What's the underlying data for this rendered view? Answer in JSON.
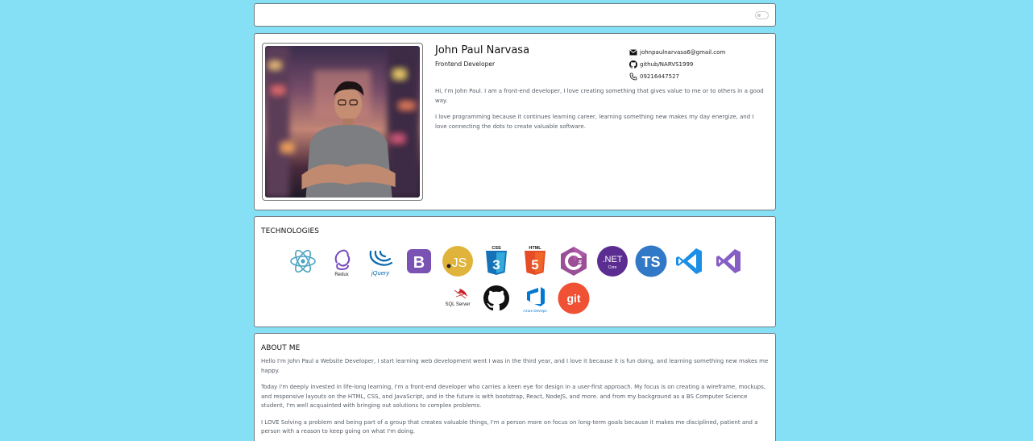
{
  "topbar": {
    "theme_toggle": "off"
  },
  "profile": {
    "name": "John Paul Narvasa",
    "role": "Frontend Developer",
    "contacts": [
      {
        "icon": "mail-icon",
        "text": "johnpaulnarvasa6@gmail.com"
      },
      {
        "icon": "github-icon",
        "text": "github/NARVS1999"
      },
      {
        "icon": "phone-icon",
        "text": "09216447527"
      }
    ],
    "bio": [
      "Hi, I'm John Paul. I am a front-end developer, I love creating something that gives value to me or to others in a good way.",
      "I love programming because it continues learning career, learning something new makes my day energize, and I love connecting the dots to create valuable software."
    ]
  },
  "technologies": {
    "title": "TECHNOLOGIES",
    "items": [
      {
        "icon": "react-icon",
        "label": ""
      },
      {
        "icon": "redux-icon",
        "label": "Redux"
      },
      {
        "icon": "jquery-icon",
        "label": "jQuery"
      },
      {
        "icon": "bootstrap-icon",
        "label": "B"
      },
      {
        "icon": "javascript-icon",
        "label": "JS"
      },
      {
        "icon": "css3-icon",
        "label": "CSS"
      },
      {
        "icon": "html5-icon",
        "label": "HTML"
      },
      {
        "icon": "csharp-icon",
        "label": "C#"
      },
      {
        "icon": "dotnet-core-icon",
        "label": ".NET"
      },
      {
        "icon": "typescript-icon",
        "label": "TS"
      },
      {
        "icon": "vscode-icon",
        "label": ""
      },
      {
        "icon": "visual-studio-icon",
        "label": ""
      },
      {
        "icon": "sql-server-icon",
        "label": "SQL Server"
      },
      {
        "icon": "github-icon",
        "label": ""
      },
      {
        "icon": "azure-devops-icon",
        "label": "Azure DevOps"
      },
      {
        "icon": "git-icon",
        "label": "git"
      }
    ],
    "sublabels": {
      "dotnet": "Core"
    },
    "colors": {
      "react": "#4aa3c2",
      "redux": "#764abc",
      "jquery": "#0769ad",
      "bootstrap": "#7952b3",
      "javascript": "#e0b33a",
      "css3": "#1572b6",
      "html5": "#e44d26",
      "csharp": "#9b4f96",
      "dotnet": "#5c2d91",
      "typescript": "#3178c6",
      "vscode": "#1b8ee6",
      "visualstudio": "#865fc5",
      "sqlserver": "#c8262c",
      "github": "#111111",
      "azure": "#0078d4",
      "git": "#f05033"
    }
  },
  "about": {
    "title": "ABOUT ME",
    "paragraphs": [
      "Hello I'm John Paul a Website Developer, I start learning web development went I was in the third year, and I love it because it is fun doing, and learning something new makes me happy.",
      "Today I'm deeply invested in life-long learning, I'm a front-end developer who carries a keen eye for design in a user-first approach. My focus is on creating a wireframe, mockups, and responsive layouts on the HTML, CSS, and JavaScript, and in the future is with bootstrap, React, NodeJS, and more. and from my background as a BS Computer Science student, I'm well acquainted with bringing out solutions to complex problems.",
      "I LOVE Solving a problem and being part of a group that creates valuable things, I'm a person more on focus on long-term goals because it makes me disciplined, patient and a person with a reason to keep going on what I'm doing."
    ]
  }
}
